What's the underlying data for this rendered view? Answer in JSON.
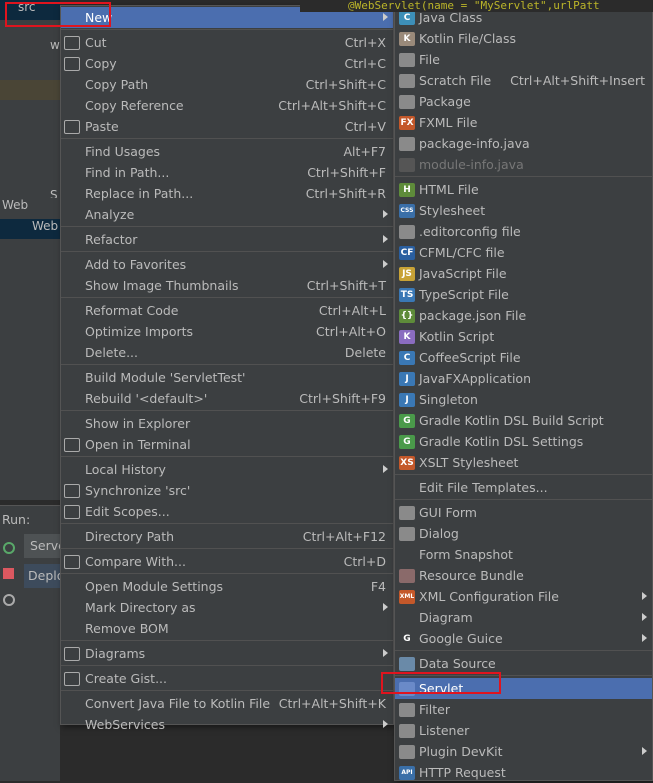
{
  "project_tree": {
    "rows": [
      "src",
      "",
      "w",
      "",
      "",
      "",
      "S",
      "Web",
      "Web"
    ]
  },
  "editor": {
    "code": "@WebServlet(name = \"MyServlet\",urlPatt"
  },
  "run_panel": {
    "label": "Run:",
    "tab1": "Serve",
    "tab2": "Deplo"
  },
  "main_menu": [
    {
      "label": "New",
      "submenu": true,
      "highlighted": true
    },
    "sep",
    {
      "label": "Cut",
      "shortcut": "Ctrl+X",
      "icon": "scissors-icon"
    },
    {
      "label": "Copy",
      "shortcut": "Ctrl+C",
      "icon": "copy-icon"
    },
    {
      "label": "Copy Path",
      "shortcut": "Ctrl+Shift+C"
    },
    {
      "label": "Copy Reference",
      "shortcut": "Ctrl+Alt+Shift+C"
    },
    {
      "label": "Paste",
      "shortcut": "Ctrl+V",
      "icon": "clipboard-icon"
    },
    "sep",
    {
      "label": "Find Usages",
      "shortcut": "Alt+F7"
    },
    {
      "label": "Find in Path...",
      "shortcut": "Ctrl+Shift+F"
    },
    {
      "label": "Replace in Path...",
      "shortcut": "Ctrl+Shift+R"
    },
    {
      "label": "Analyze",
      "submenu": true
    },
    "sep",
    {
      "label": "Refactor",
      "submenu": true
    },
    "sep",
    {
      "label": "Add to Favorites",
      "submenu": true
    },
    {
      "label": "Show Image Thumbnails",
      "shortcut": "Ctrl+Shift+T"
    },
    "sep",
    {
      "label": "Reformat Code",
      "shortcut": "Ctrl+Alt+L"
    },
    {
      "label": "Optimize Imports",
      "shortcut": "Ctrl+Alt+O"
    },
    {
      "label": "Delete...",
      "shortcut": "Delete"
    },
    "sep",
    {
      "label": "Build Module 'ServletTest'"
    },
    {
      "label": "Rebuild '<default>'",
      "shortcut": "Ctrl+Shift+F9"
    },
    "sep",
    {
      "label": "Show in Explorer"
    },
    {
      "label": "Open in Terminal",
      "icon": "terminal-icon"
    },
    "sep",
    {
      "label": "Local History",
      "submenu": true
    },
    {
      "label": "Synchronize 'src'",
      "icon": "sync-icon"
    },
    {
      "label": "Edit Scopes...",
      "icon": "scope-icon"
    },
    "sep",
    {
      "label": "Directory Path",
      "shortcut": "Ctrl+Alt+F12"
    },
    "sep",
    {
      "label": "Compare With...",
      "shortcut": "Ctrl+D",
      "icon": "compare-icon"
    },
    "sep",
    {
      "label": "Open Module Settings",
      "shortcut": "F4"
    },
    {
      "label": "Mark Directory as",
      "submenu": true
    },
    {
      "label": "Remove BOM"
    },
    "sep",
    {
      "label": "Diagrams",
      "submenu": true,
      "icon": "diagram-icon"
    },
    "sep",
    {
      "label": "Create Gist...",
      "icon": "github-icon"
    },
    "sep",
    {
      "label": "Convert Java File to Kotlin File",
      "shortcut": "Ctrl+Alt+Shift+K"
    },
    {
      "label": "WebServices",
      "submenu": true
    }
  ],
  "new_submenu": [
    {
      "label": "Java Class",
      "icon": "java-class-icon",
      "color": "#3d8fb8",
      "glyph": "C"
    },
    {
      "label": "Kotlin File/Class",
      "icon": "kotlin-file-icon",
      "color": "#9a8a7a",
      "glyph": "K"
    },
    {
      "label": "File",
      "icon": "file-icon",
      "color": "#8a8a8a",
      "glyph": ""
    },
    {
      "label": "Scratch File",
      "shortcut": "Ctrl+Alt+Shift+Insert",
      "icon": "scratch-file-icon",
      "color": "#8a8a8a",
      "glyph": ""
    },
    {
      "label": "Package",
      "icon": "package-icon",
      "color": "#8a8a8a",
      "glyph": ""
    },
    {
      "label": "FXML File",
      "icon": "fxml-icon",
      "color": "#c4582a",
      "glyph": "FX"
    },
    {
      "label": "package-info.java",
      "icon": "package-info-icon",
      "color": "#8a8a8a",
      "glyph": ""
    },
    {
      "label": "module-info.java",
      "icon": "module-info-icon",
      "color": "#555",
      "glyph": "",
      "disabled": true
    },
    "sep",
    {
      "label": "HTML File",
      "icon": "html-icon",
      "color": "#5e8c3a",
      "glyph": "H"
    },
    {
      "label": "Stylesheet",
      "icon": "css-icon",
      "color": "#3a6fa8",
      "glyph": "CSS"
    },
    {
      "label": ".editorconfig file",
      "icon": "editorconfig-icon",
      "color": "#8a8a8a",
      "glyph": ""
    },
    {
      "label": "CFML/CFC file",
      "icon": "cfml-icon",
      "color": "#2a5fa0",
      "glyph": "CF"
    },
    {
      "label": "JavaScript File",
      "icon": "javascript-icon",
      "color": "#c8a236",
      "glyph": "JS"
    },
    {
      "label": "TypeScript File",
      "icon": "typescript-icon",
      "color": "#3a78b5",
      "glyph": "TS"
    },
    {
      "label": "package.json File",
      "icon": "npm-icon",
      "color": "#5e8c3a",
      "glyph": "{}"
    },
    {
      "label": "Kotlin Script",
      "icon": "kotlin-script-icon",
      "color": "#8a6cc0",
      "glyph": "K"
    },
    {
      "label": "CoffeeScript File",
      "icon": "coffeescript-icon",
      "color": "#3a78b5",
      "glyph": "C"
    },
    {
      "label": "JavaFXApplication",
      "icon": "javafx-icon",
      "color": "#3a78b5",
      "glyph": "J"
    },
    {
      "label": "Singleton",
      "icon": "singleton-icon",
      "color": "#3a78b5",
      "glyph": "J"
    },
    {
      "label": "Gradle Kotlin DSL Build Script",
      "icon": "gradle-icon",
      "color": "#4a9a4a",
      "glyph": "G"
    },
    {
      "label": "Gradle Kotlin DSL Settings",
      "icon": "gradle-icon",
      "color": "#4a9a4a",
      "glyph": "G"
    },
    {
      "label": "XSLT Stylesheet",
      "icon": "xslt-icon",
      "color": "#c4582a",
      "glyph": "XS"
    },
    "sep",
    {
      "label": "Edit File Templates..."
    },
    "sep",
    {
      "label": "GUI Form",
      "icon": "gui-form-icon",
      "color": "#8a8a8a",
      "glyph": ""
    },
    {
      "label": "Dialog",
      "icon": "dialog-icon",
      "color": "#8a8a8a",
      "glyph": ""
    },
    {
      "label": "Form Snapshot"
    },
    {
      "label": "Resource Bundle",
      "icon": "resource-bundle-icon",
      "color": "#8a6a6a",
      "glyph": ""
    },
    {
      "label": "XML Configuration File",
      "submenu": true,
      "icon": "xml-icon",
      "color": "#c4582a",
      "glyph": "XML"
    },
    {
      "label": "Diagram",
      "submenu": true
    },
    {
      "label": "Google Guice",
      "submenu": true,
      "icon": "google-icon",
      "color": "#3c3f41",
      "glyph": "G"
    },
    "sep",
    {
      "label": "Data Source",
      "icon": "database-icon",
      "color": "#6a8aa8",
      "glyph": ""
    },
    "sep",
    {
      "label": "Servlet",
      "highlighted": true,
      "icon": "servlet-icon",
      "color": "#6a8ac8",
      "glyph": ""
    },
    {
      "label": "Filter",
      "icon": "filter-icon",
      "color": "#8a8a8a",
      "glyph": ""
    },
    {
      "label": "Listener",
      "icon": "listener-icon",
      "color": "#8a8a8a",
      "glyph": ""
    },
    {
      "label": "Plugin DevKit",
      "submenu": true,
      "icon": "plugin-icon",
      "color": "#8a8a8a",
      "glyph": ""
    },
    {
      "label": "HTTP Request",
      "icon": "http-request-icon",
      "color": "#3a6fa8",
      "glyph": "API"
    }
  ]
}
